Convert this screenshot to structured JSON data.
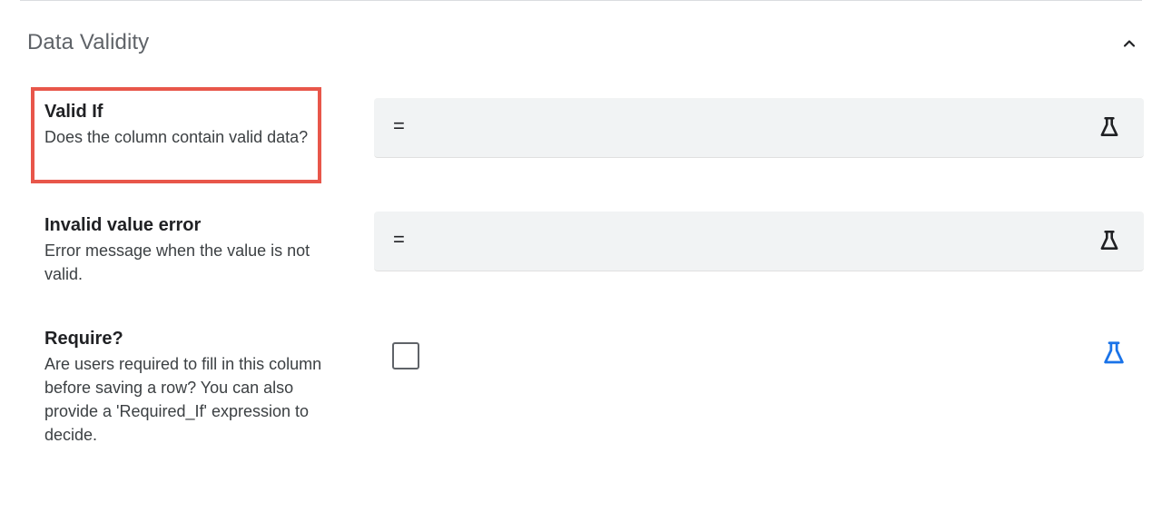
{
  "section": {
    "title": "Data Validity",
    "collapse_icon": "chevron-up-icon"
  },
  "fields": {
    "valid_if": {
      "title": "Valid If",
      "description": "Does the column contain valid data?",
      "value": "=",
      "icon": "flask-icon"
    },
    "invalid_value_error": {
      "title": "Invalid value error",
      "description": "Error message when the value is not valid.",
      "value": "=",
      "icon": "flask-icon"
    },
    "require": {
      "title": "Require?",
      "description": "Are users required to fill in this column before saving a row? You can also provide a 'Required_If' expression to decide.",
      "checked": false,
      "icon": "flask-icon"
    }
  },
  "colors": {
    "highlight": "#e8564a",
    "accent_blue": "#1a73e8",
    "field_bg": "#f1f3f4"
  }
}
